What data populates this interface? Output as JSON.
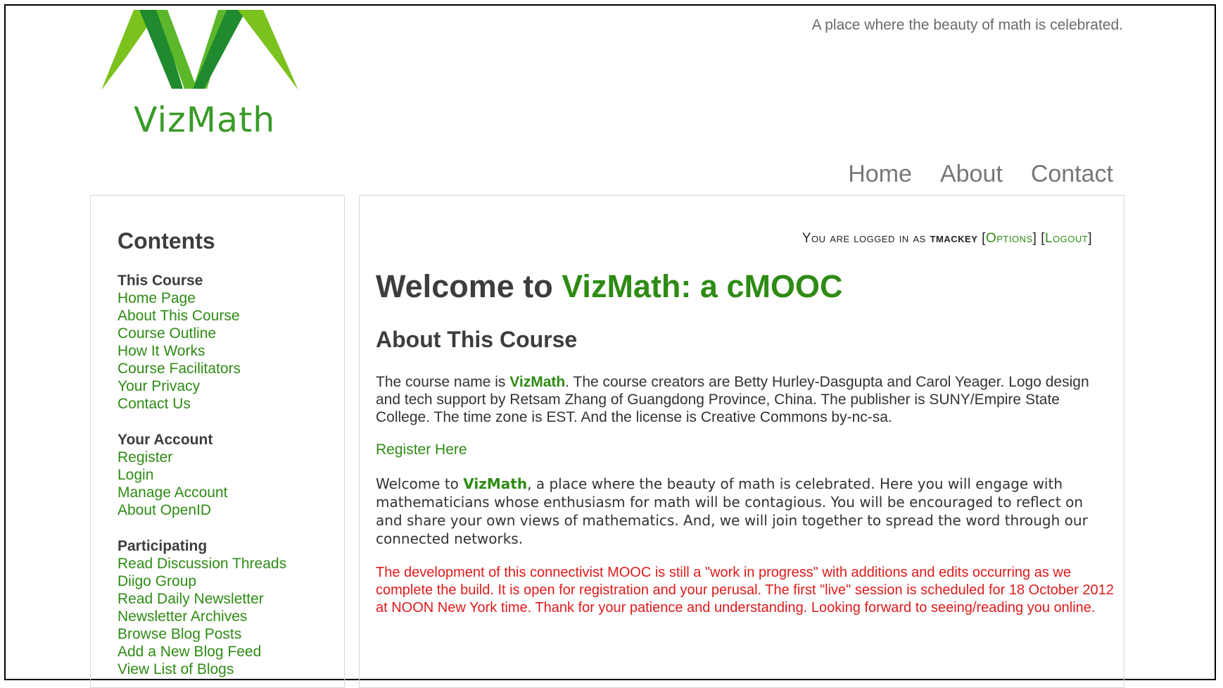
{
  "site": {
    "logo_text": "VizMath",
    "tagline": "A place where the beauty of math is celebrated."
  },
  "nav": {
    "items": [
      {
        "label": "Home"
      },
      {
        "label": "About"
      },
      {
        "label": "Contact"
      }
    ]
  },
  "sidebar": {
    "title": "Contents",
    "sections": [
      {
        "heading": "This Course",
        "links": [
          "Home Page",
          "About This Course",
          "Course Outline",
          "How It Works",
          "Course Facilitators",
          "Your Privacy",
          "Contact Us"
        ]
      },
      {
        "heading": "Your Account",
        "links": [
          "Register",
          "Login",
          "Manage Account",
          "About OpenID"
        ]
      },
      {
        "heading": "Participating",
        "links": [
          "Read Discussion Threads",
          "Diigo Group",
          "Read Daily Newsletter",
          "Newsletter Archives",
          "Browse Blog Posts",
          "Add a New Blog Feed",
          "View List of Blogs"
        ]
      }
    ]
  },
  "login": {
    "prefix": "You are logged in as",
    "username": "tmackey",
    "options_label": "Options",
    "logout_label": "Logout"
  },
  "main": {
    "welcome_prefix": "Welcome to ",
    "welcome_highlight": "VizMath: a cMOOC",
    "about_title": "About This Course",
    "p1_before": "The course name is ",
    "p1_brand": "VizMath",
    "p1_after": ". The course creators are Betty Hurley-Dasgupta and Carol Yeager. Logo design and tech support by Retsam Zhang of Guangdong Province, China. The publisher is SUNY/Empire State College. The time zone is EST. And the license is Creative Commons by-nc-sa.",
    "register_label": "Register Here",
    "p3_before": "Welcome to ",
    "p3_brand": "VizMath",
    "p3_after": ", a place where the beauty of math is celebrated.  Here you will engage with mathematicians whose enthusiasm for math will be contagious. You will be encouraged to reflect on and share your own views of mathematics.  And, we will join together to spread the word through our connected networks.",
    "notice": "The development of this connectivist MOOC is still a \"work in progress\" with additions and edits occurring as we complete the build.  It is open for registration and your perusal.  The first \"live\" session is scheduled for 18 October 2012 at NOON New York time.  Thank for your patience and understanding.  Looking forward to seeing/reading you online."
  },
  "colors": {
    "brand_green": "#2e8b14",
    "notice_red": "#e01a1a",
    "logo_light_green": "#7cc21e",
    "logo_dark_green": "#1f8a2e"
  }
}
